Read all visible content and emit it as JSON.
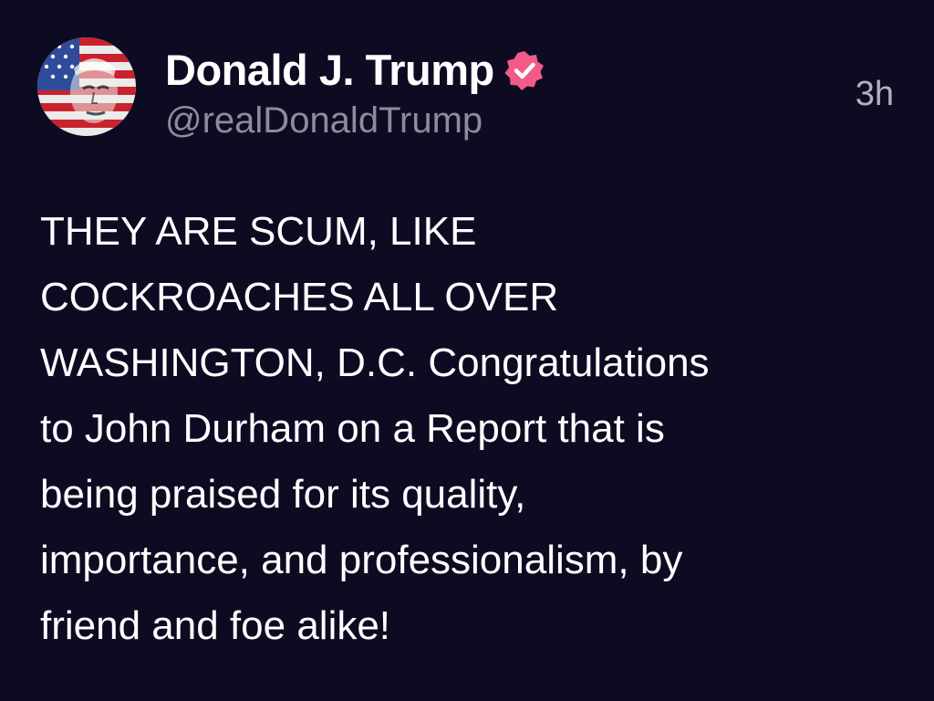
{
  "author": {
    "display_name": "Donald J. Trump",
    "handle": "@realDonaldTrump",
    "verified": true,
    "avatar_icon": "avatar-flag-portrait",
    "badge_icon": "verified-badge-icon",
    "badge_color": "#f25a88"
  },
  "post": {
    "timestamp": "3h",
    "text": "THEY ARE SCUM, LIKE COCKROACHES ALL OVER WASHINGTON, D.C. Congratulations to John Durham on a Report that is being praised for its quality, importance, and professionalism, by friend and foe alike!",
    "lines": [
      "THEY ARE SCUM, LIKE",
      "COCKROACHES ALL OVER",
      "WASHINGTON, D.C. Congratulations",
      "to John Durham on a Report that is",
      "being praised for its quality,",
      "importance, and professionalism, by",
      "friend and foe alike!"
    ]
  },
  "theme": {
    "background": "#0d0b22",
    "text": "#ffffff",
    "muted": "#8d8b9c"
  }
}
